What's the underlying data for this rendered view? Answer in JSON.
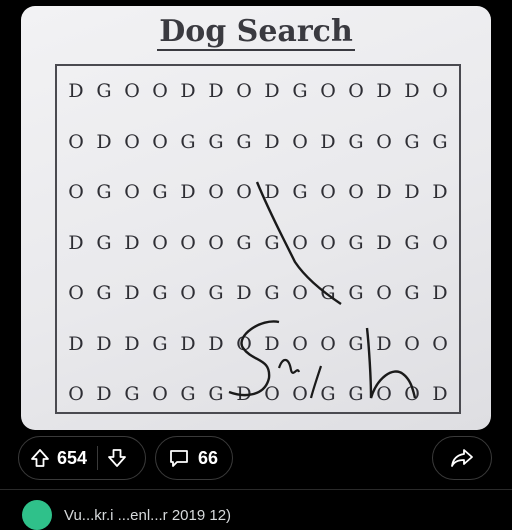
{
  "post": {
    "image": {
      "title": "Dog Search",
      "grid": [
        "DGOODDODGOODDO",
        "ODOOGGGDODGOGG",
        "OGOGDOODGOODDD",
        "DGDOOOGGOOGDGO",
        "OGDGOGDGOGGOGD",
        "DDDGDDODOOGDOO",
        "ODGOGGDOOGGOOD"
      ],
      "handwriting": "Sarah"
    },
    "actions": {
      "upvote_count": "654",
      "comment_count": "66"
    }
  },
  "next_comment": {
    "text": "Vu...kr.i ...enl...r 2019 12)"
  },
  "colors": {
    "background": "#000000",
    "pill_border": "#3a3a3a",
    "avatar": "#2fc18a"
  }
}
